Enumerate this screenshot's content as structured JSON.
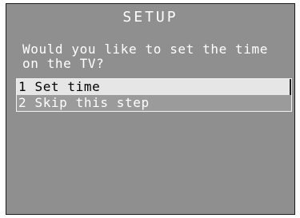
{
  "screen": {
    "title": "SETUP",
    "question": "Would you like to set the time on the TV?",
    "menu": {
      "items": [
        {
          "label": "1 Set time",
          "selected": true
        },
        {
          "label": "2 Skip this step",
          "selected": false
        }
      ]
    }
  },
  "colors": {
    "background": "#8f8f8f",
    "highlight": "#e6e6e6",
    "text": "#ffffff"
  }
}
